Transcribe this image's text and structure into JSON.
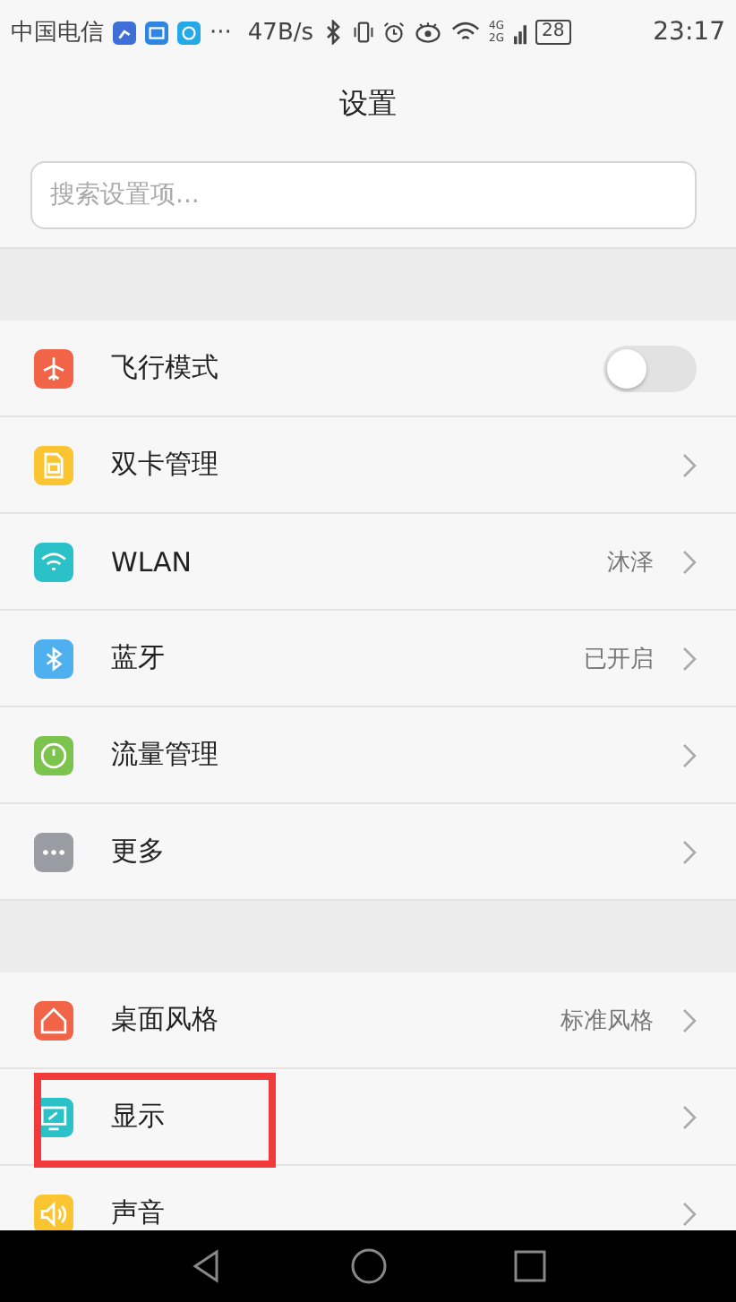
{
  "status_bar": {
    "carrier": "中国电信",
    "more": "···",
    "speed": "47B/s",
    "network": "4G",
    "network_2": "2G",
    "battery": "28",
    "time": "23:17"
  },
  "title": "设置",
  "search": {
    "placeholder": "搜索设置项..."
  },
  "sections": [
    {
      "items": [
        {
          "label": "飞行模式",
          "kind": "toggle",
          "on": false,
          "color": "#f26448",
          "highlighted": false
        },
        {
          "label": "双卡管理",
          "kind": "link",
          "color": "#fbc531",
          "highlighted": false
        },
        {
          "label": "WLAN",
          "kind": "link",
          "value": "沐泽",
          "color": "#2ac2c8",
          "highlighted": false
        },
        {
          "label": "蓝牙",
          "kind": "link",
          "value": "已开启",
          "color": "#4fb0f0",
          "highlighted": false
        },
        {
          "label": "流量管理",
          "kind": "link",
          "color": "#7cc44e",
          "highlighted": false
        },
        {
          "label": "更多",
          "kind": "link",
          "color": "#9a9ca3",
          "highlighted": false
        }
      ]
    },
    {
      "items": [
        {
          "label": "桌面风格",
          "kind": "link",
          "value": "标准风格",
          "color": "#f26448",
          "highlighted": false
        },
        {
          "label": "显示",
          "kind": "link",
          "color": "#2ac2c8",
          "highlighted": true
        },
        {
          "label": "声音",
          "kind": "link",
          "color": "#fbc531",
          "highlighted": false
        }
      ]
    }
  ]
}
